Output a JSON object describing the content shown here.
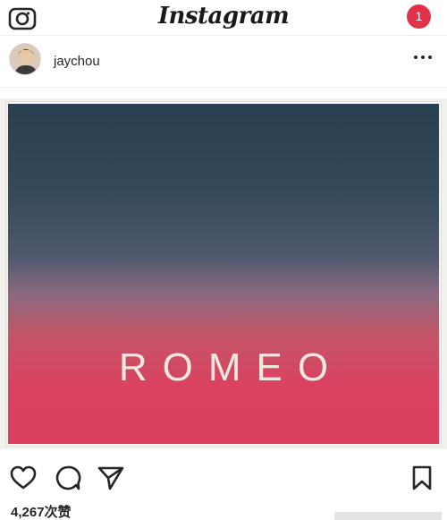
{
  "topbar": {
    "brand": "Instagram",
    "notification_count": "1",
    "icons": [
      "camera-icon"
    ]
  },
  "post": {
    "username": "jaychou",
    "image_text": "ROMEO",
    "more_icon": "more-dots-icon"
  },
  "actions": {
    "icons": [
      "heart-icon",
      "comment-icon",
      "share-icon",
      "bookmark-icon"
    ]
  },
  "likes": {
    "count": "4,267",
    "suffix": "次赞"
  },
  "colors": {
    "notification_badge": "#e0334a",
    "gradient_top": "#2a3f4f",
    "gradient_bottom": "#dc3f5d"
  }
}
